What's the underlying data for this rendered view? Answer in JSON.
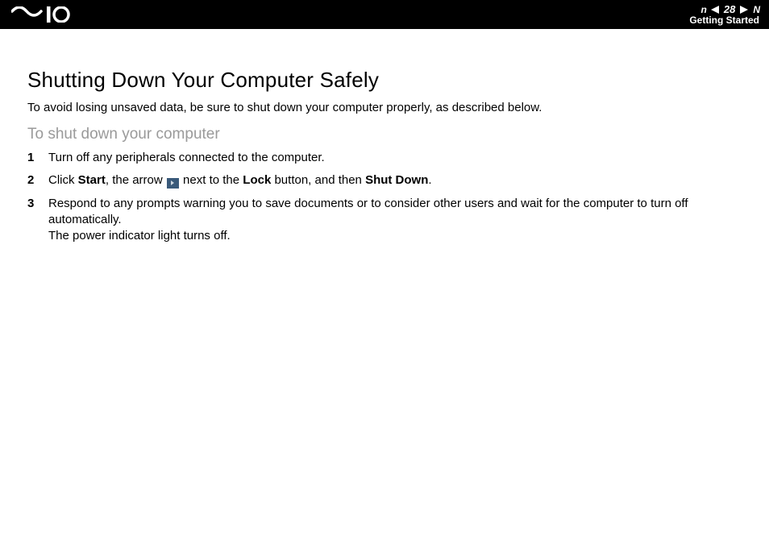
{
  "header": {
    "page_number": "28",
    "section": "Getting Started",
    "n_letter": "n",
    "N_letter": "N"
  },
  "title": "Shutting Down Your Computer Safely",
  "intro": "To avoid losing unsaved data, be sure to shut down your computer properly, as described below.",
  "subheading": "To shut down your computer",
  "steps": {
    "s1": "Turn off any peripherals connected to the computer.",
    "s2_a": "Click ",
    "s2_b": "Start",
    "s2_c": ", the arrow ",
    "s2_d": " next to the ",
    "s2_e": "Lock",
    "s2_f": " button, and then ",
    "s2_g": "Shut Down",
    "s2_h": ".",
    "s3_a": "Respond to any prompts warning you to save documents or to consider other users and wait for the computer to turn off automatically.",
    "s3_b": "The power indicator light turns off."
  }
}
